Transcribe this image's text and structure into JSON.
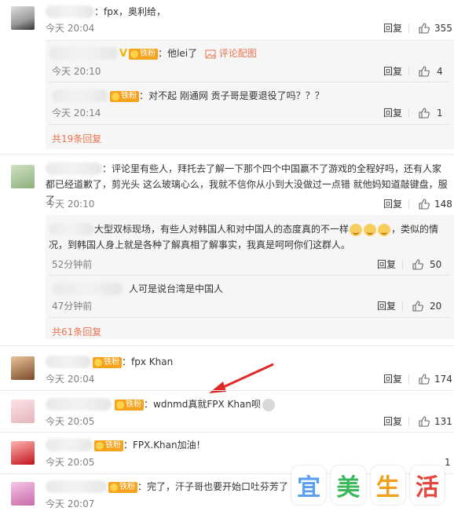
{
  "comments": [
    {
      "name_suffix": "：",
      "text": "fpx，奥利给，",
      "time": "今天 20:04",
      "reply": "回复",
      "likes": "355"
    },
    {
      "name_suffix": "：",
      "text": "评论里有些人，拜托去了解一下那个四个中国赢不了游戏的全程好吗，还有人家都已经道歉了，剪光头  这么玻璃心么，我就不信你从小到大没做过一点错 就他妈知道敲键盘，服了",
      "time": "今天 20:10",
      "reply": "回复",
      "likes": "148"
    },
    {
      "name_suffix": "：",
      "text": "fpx Khan",
      "time": "今天 20:04",
      "reply": "回复",
      "likes": "174"
    },
    {
      "name_suffix": "：",
      "text": "wdnmd真就FPX Khan呗",
      "time": "今天 20:05",
      "reply": "回复",
      "likes": "131"
    },
    {
      "name_suffix": "：",
      "text": "FPX.Khan加油！",
      "time": "今天 20:05",
      "reply": "回复",
      "likes": "1"
    },
    {
      "name_suffix": "：",
      "text": "完了，汗子哥也要开始口吐芬芳了",
      "time": "今天 20:07",
      "reply": "回复",
      "likes": ""
    }
  ],
  "sub1": [
    {
      "text": "：他lei了",
      "extra": "评论配图",
      "time": "今天 20:10",
      "reply": "回复",
      "likes": "4"
    },
    {
      "text": "：对不起 刚通网  贡子哥是要退役了吗？？？",
      "time": "今天 20:14",
      "reply": "回复",
      "likes": "1"
    }
  ],
  "sub1_more": "共19条回复",
  "sub2": [
    {
      "text": "大型双标现场，有些人对韩国人和对中国人的态度真的不一样",
      "text2": "，类似的情况，到韩国人身上就是各种了解真相了解事实，我真是呵呵你们这群人。",
      "time": "52分钟前",
      "reply": "回复",
      "likes": "50"
    },
    {
      "text": "人可是说台湾是中国人",
      "time": "47分钟前",
      "reply": "回复",
      "likes": "20"
    }
  ],
  "sub2_more": "共61条回复",
  "badge": "铁粉",
  "watermark": [
    "宜",
    "美",
    "生",
    "活"
  ],
  "colors": {
    "accent": "#eb7350",
    "badge": "#f7a21b",
    "vip": "#f6b600",
    "arrow": "#e02a2a"
  }
}
